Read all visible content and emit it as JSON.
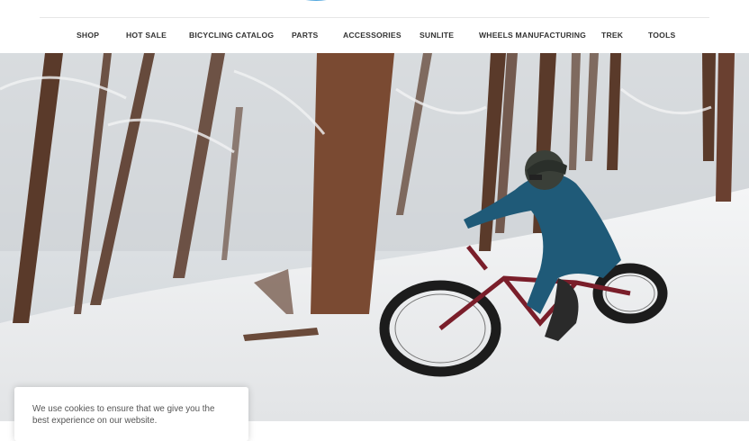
{
  "nav": {
    "items": [
      {
        "label": "SHOP"
      },
      {
        "label": "HOT SALE"
      },
      {
        "label": "BICYCLING CATALOG"
      },
      {
        "label": "PARTS"
      },
      {
        "label": "ACCESSORIES"
      },
      {
        "label": "SUNLITE"
      },
      {
        "label": "WHEELS MANUFACTURING"
      },
      {
        "label": "TREK"
      },
      {
        "label": "TOOLS"
      }
    ]
  },
  "cookie_banner": {
    "text": "We use cookies to ensure that we give you the best experience on our website."
  },
  "colors": {
    "nav_text": "#333333",
    "logo_accent": "#3a9bd9"
  }
}
